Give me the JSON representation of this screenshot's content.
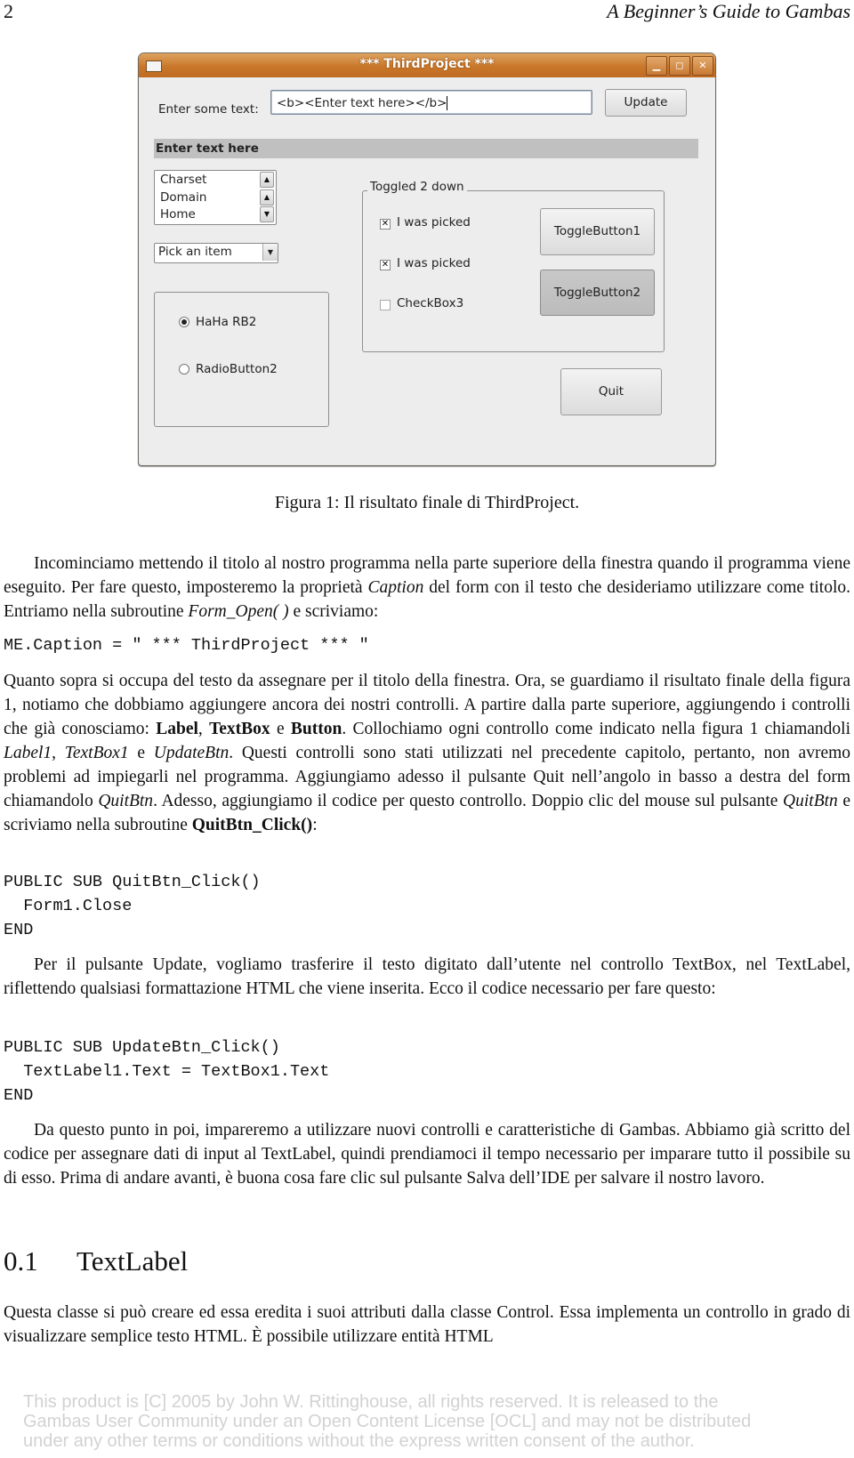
{
  "header": {
    "page_number": "2",
    "running_title": "A Beginner’s Guide to Gambas"
  },
  "window": {
    "title": "*** ThirdProject ***",
    "titlebar_buttons": {
      "minimize": "▁",
      "maximize": "◻",
      "close": "✕"
    },
    "label_enter": "Enter some text:",
    "textbox_value": "<b><Enter text here></b>",
    "update_button": "Update",
    "textlabel_text": "Enter text here",
    "listbox_items": [
      "Charset",
      "Domain",
      "Home"
    ],
    "combo_value": "Pick an item",
    "radio_buttons": [
      {
        "label": "HaHa RB2",
        "selected": true
      },
      {
        "label": "RadioButton2",
        "selected": false
      }
    ],
    "frame_title": "Toggled 2 down",
    "checkboxes": [
      {
        "label": "I was picked",
        "checked": true
      },
      {
        "label": "I was picked",
        "checked": true
      },
      {
        "label": "CheckBox3",
        "checked": false
      }
    ],
    "toggle_buttons": [
      {
        "label": "ToggleButton1",
        "pressed": false
      },
      {
        "label": "ToggleButton2",
        "pressed": true
      }
    ],
    "quit_button": "Quit",
    "check_mark": "✕",
    "arrow_up": "▲",
    "arrow_down": "▼"
  },
  "figure_caption": "Figura 1: Il risultato finale di ThirdProject.",
  "paragraphs": {
    "p1": {
      "a": "Incominciamo mettendo il titolo al nostro programma nella parte superiore della finestra quando il programma viene eseguito. Per fare questo, imposteremo la proprietà ",
      "b_italic": "Caption",
      "c": " del form con il testo che desideriamo utilizzare come titolo. Entriamo nella subroutine ",
      "d_italic": "Form_Open( )",
      "e": " e scriviamo:"
    },
    "code1": "ME.Caption = \" *** ThirdProject *** \"",
    "p2": {
      "a": "Quanto sopra si occupa del testo da assegnare per il titolo della finestra. Ora, se guardiamo il risultato finale della figura 1, notiamo che dobbiamo aggiungere ancora dei nostri controlli. A partire dalla parte superiore, aggiungendo i controlli che già conosciamo: ",
      "b_bold": "Label",
      "c": ", ",
      "d_bold": "TextBox",
      "e": " e ",
      "f_bold": "Button",
      "g": ". Collochiamo ogni controllo come indicato nella figura 1 chiamandoli ",
      "h_italic": "Label1",
      "i": ", ",
      "j_italic": "TextBox1",
      "k": " e ",
      "l_italic": "UpdateBtn",
      "m": ". Questi controlli sono stati utilizzati nel precedente capitolo, pertanto, non avremo problemi ad impiegarli nel programma. Aggiungiamo adesso il pulsante Quit nell’angolo in basso a destra del form chiamandolo ",
      "n_italic": "QuitBtn",
      "o": ". Adesso, aggiungiamo il codice per questo controllo. Doppio clic del mouse sul pulsante ",
      "p_italic": "QuitBtn",
      "q": " e scriviamo nella subroutine ",
      "r_bold": "QuitBtn_Click()",
      "s": ":"
    },
    "code2": "PUBLIC SUB QuitBtn_Click()\n  Form1.Close\nEND",
    "p3": "Per il pulsante Update, vogliamo trasferire il testo digitato dall’utente nel controllo TextBox, nel TextLabel, riflettendo qualsiasi formattazione HTML che viene inserita. Ecco il codice necessario per fare questo:",
    "code3": "PUBLIC SUB UpdateBtn_Click()\n  TextLabel1.Text = TextBox1.Text\nEND",
    "p4": "Da questo punto in poi, impareremo a utilizzare nuovi controlli e caratteristiche di Gambas. Abbiamo già scritto del codice per assegnare dati di input al TextLabel, quindi prendiamoci il tempo necessario per imparare tutto il possibile su di esso. Prima di andare avanti, è buona cosa fare clic sul pulsante Salva dell’IDE per salvare il nostro lavoro.",
    "p5": "Questa classe si può creare ed essa eredita i suoi attributi dalla classe Control. Essa implementa un controllo in grado di visualizzare semplice testo HTML. È possibile utilizzare entità HTML"
  },
  "section": {
    "number": "0.1",
    "title": "TextLabel"
  },
  "footer": {
    "line1": "This product is [C] 2005 by John W. Rittinghouse, all rights reserved. It is released to the",
    "line2": "Gambas User Community under an Open Content License [OCL] and may not be distributed",
    "line3": "under any other terms or conditions without the express written consent of the author."
  },
  "colors": {
    "titlebar": "#c9772a",
    "window_bg": "#ededed",
    "textlabel_bg": "#c0c0c0",
    "footer_text": "#d2d2d2"
  }
}
